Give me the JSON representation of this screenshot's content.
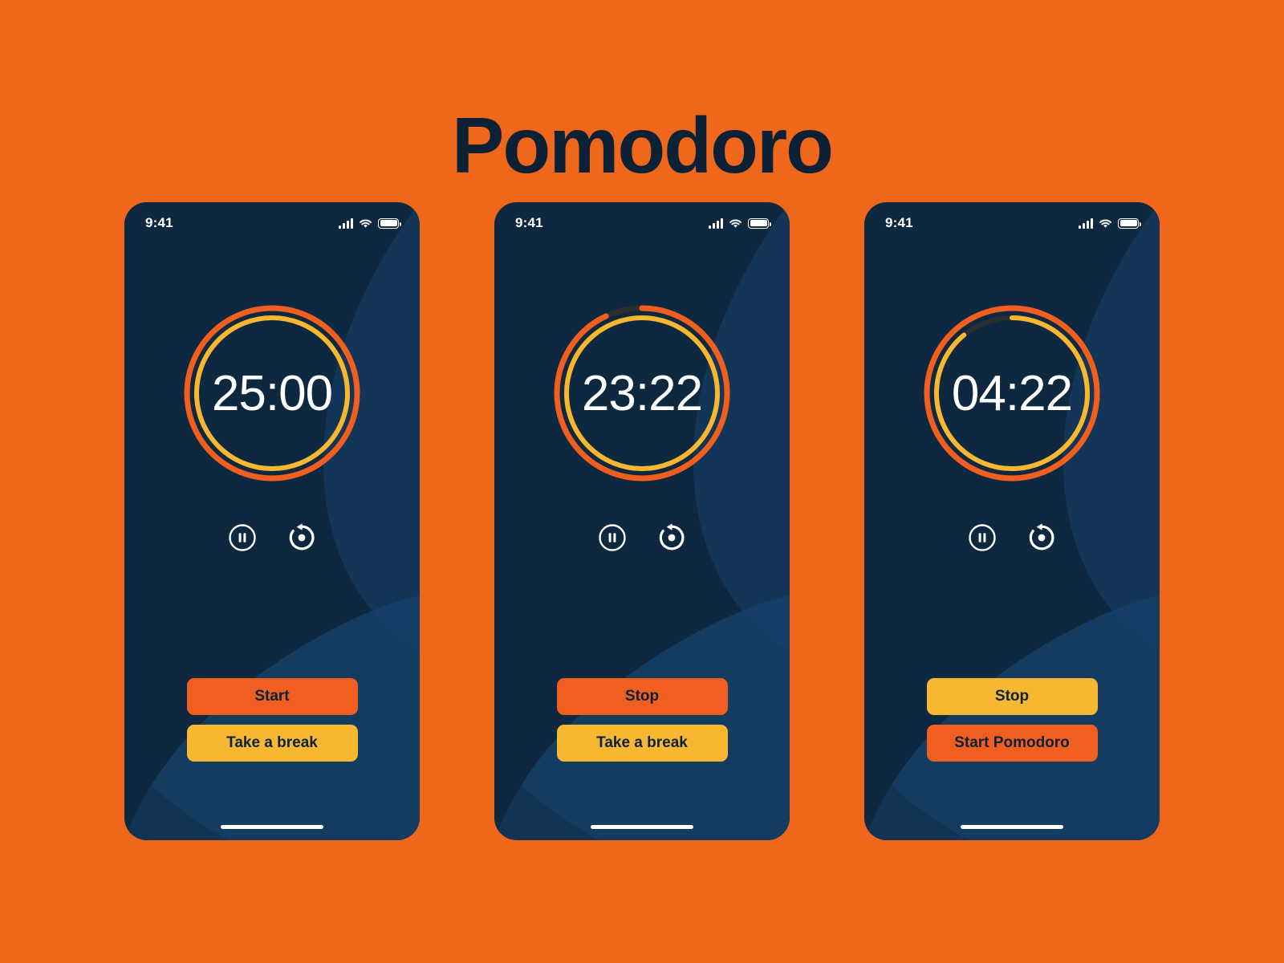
{
  "page": {
    "title": "Pomodoro",
    "background_color": "#EF671A",
    "title_color": "#0D2136"
  },
  "theme": {
    "orange": "#F05E20",
    "yellow": "#F7B731",
    "navy_dark": "#0E2840",
    "navy_mid": "#123352",
    "navy_light": "#17416B",
    "track_gray": "#2A2E30",
    "text_white": "#FFFFFF",
    "text_navy": "#0D2136"
  },
  "status_bar": {
    "time": "9:41",
    "cellular_icon": "signal-bars-icon",
    "wifi_icon": "wifi-icon",
    "battery_icon": "battery-icon"
  },
  "controls": {
    "pause_icon": "pause-circle-icon",
    "reset_icon": "reset-rotate-icon"
  },
  "screens": [
    {
      "id": "idle",
      "timer": "25:00",
      "outer_ring": {
        "color": "#F05E20",
        "progress_pct": 100
      },
      "inner_ring": {
        "color": "#F7B731",
        "progress_pct": 100
      },
      "buttons": [
        {
          "label": "Start",
          "style": "orange"
        },
        {
          "label": "Take a break",
          "style": "yellow"
        }
      ]
    },
    {
      "id": "running-focus",
      "timer": "23:22",
      "outer_ring": {
        "color": "#F05E20",
        "progress_pct": 93
      },
      "inner_ring": {
        "color": "#F7B731",
        "progress_pct": 100
      },
      "buttons": [
        {
          "label": "Stop",
          "style": "orange"
        },
        {
          "label": "Take a break",
          "style": "yellow"
        }
      ]
    },
    {
      "id": "running-break",
      "timer": "04:22",
      "outer_ring": {
        "color": "#F05E20",
        "progress_pct": 100
      },
      "inner_ring": {
        "color": "#F7B731",
        "progress_pct": 89
      },
      "buttons": [
        {
          "label": "Stop",
          "style": "yellow"
        },
        {
          "label": "Start Pomodoro",
          "style": "orange"
        }
      ]
    }
  ]
}
